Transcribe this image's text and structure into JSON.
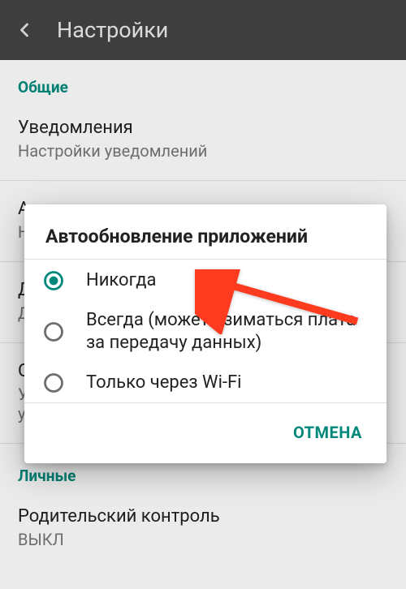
{
  "toolbar": {
    "title": "Настройки"
  },
  "sections": {
    "general": {
      "header": "Общие",
      "notifications": {
        "primary": "Уведомления",
        "secondary": "Настройки уведомлений"
      },
      "autoupdate_row": {
        "primary_cut": "А",
        "secondary_cut": "Н"
      },
      "download_pref": {
        "primary_cut": "Д",
        "secondary_cut": "Д"
      },
      "clear_history": {
        "primary_cut": "О",
        "secondary_line1_cut": "У",
        "secondary_line2_cut": "у"
      }
    },
    "personal": {
      "header": "Личные",
      "parental": {
        "primary": "Родительский контроль",
        "secondary": "ВЫКЛ"
      }
    }
  },
  "dialog": {
    "title": "Автообновление приложений",
    "options": [
      {
        "label": "Никогда",
        "selected": true
      },
      {
        "label": "Всегда (может взиматься плата за передачу данных)",
        "selected": false
      },
      {
        "label": "Только через Wi-Fi",
        "selected": false
      }
    ],
    "cancel": "ОТМЕНА"
  },
  "colors": {
    "accent": "#00897b",
    "arrow": "#ff3b1f"
  }
}
